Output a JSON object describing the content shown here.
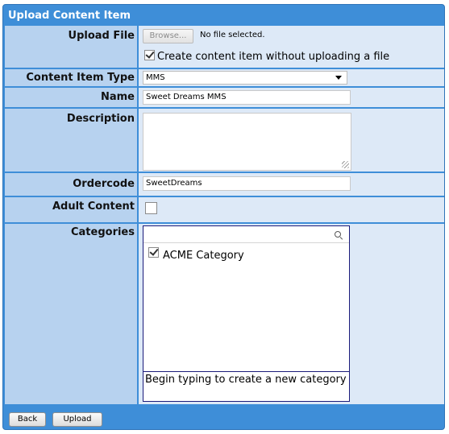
{
  "panel": {
    "title": "Upload Content Item"
  },
  "upload_file": {
    "label": "Upload File",
    "browse_label": "Browse...",
    "file_status": "No file selected.",
    "create_without_upload_label": "Create content item without uploading a file",
    "create_without_upload_checked": true
  },
  "content_item_type": {
    "label": "Content Item Type",
    "value": "MMS"
  },
  "name": {
    "label": "Name",
    "value": "Sweet Dreams MMS"
  },
  "description": {
    "label": "Description",
    "value": ""
  },
  "ordercode": {
    "label": "Ordercode",
    "value": "SweetDreams"
  },
  "adult_content": {
    "label": "Adult Content",
    "checked": false
  },
  "categories": {
    "label": "Categories",
    "search_value": "",
    "items": [
      {
        "label": "ACME Category",
        "checked": true
      }
    ],
    "hint": "Begin typing to create a new category"
  },
  "buttons": {
    "back": "Back",
    "upload": "Upload"
  },
  "colors": {
    "header_blue": "#3e8ed8",
    "label_cell": "#b7d2ef",
    "field_cell": "#dde9f7",
    "category_border": "#1b1b7a"
  }
}
